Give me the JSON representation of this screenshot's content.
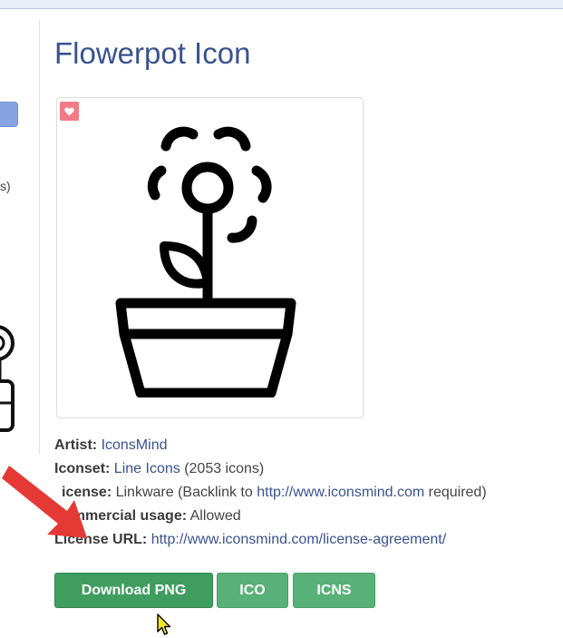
{
  "sidebar": {
    "text_fragment": "s)"
  },
  "main": {
    "title": "Flowerpot Icon"
  },
  "icons": {
    "favorite": "heart-icon",
    "preview": "flowerpot-icon",
    "cursor": "mouse-cursor-icon",
    "annotation": "red-arrow-icon"
  },
  "colors": {
    "title": "#3a5290",
    "link": "#3a5290",
    "button": "#3f9d5f",
    "button_light": "#58b176",
    "favorite_badge": "#f17b86",
    "arrow": "#e53935"
  },
  "details": {
    "artist_label": "Artist:",
    "artist_value": "IconsMind",
    "iconset_label": "Iconset:",
    "iconset_value": "Line Icons",
    "iconset_count": "(2053 icons)",
    "license_label": "icense:",
    "license_value": "Linkware (Backlink to",
    "license_link": "http://www.iconsmind.com",
    "license_suffix": "required)",
    "commercial_label": "ommercial usage:",
    "commercial_value": "Allowed",
    "license_url_label": "License URL:",
    "license_url_value": "http://www.iconsmind.com/license-agreement/"
  },
  "downloads": {
    "png_label": "Download PNG",
    "ico_label": "ICO",
    "icns_label": "ICNS"
  }
}
